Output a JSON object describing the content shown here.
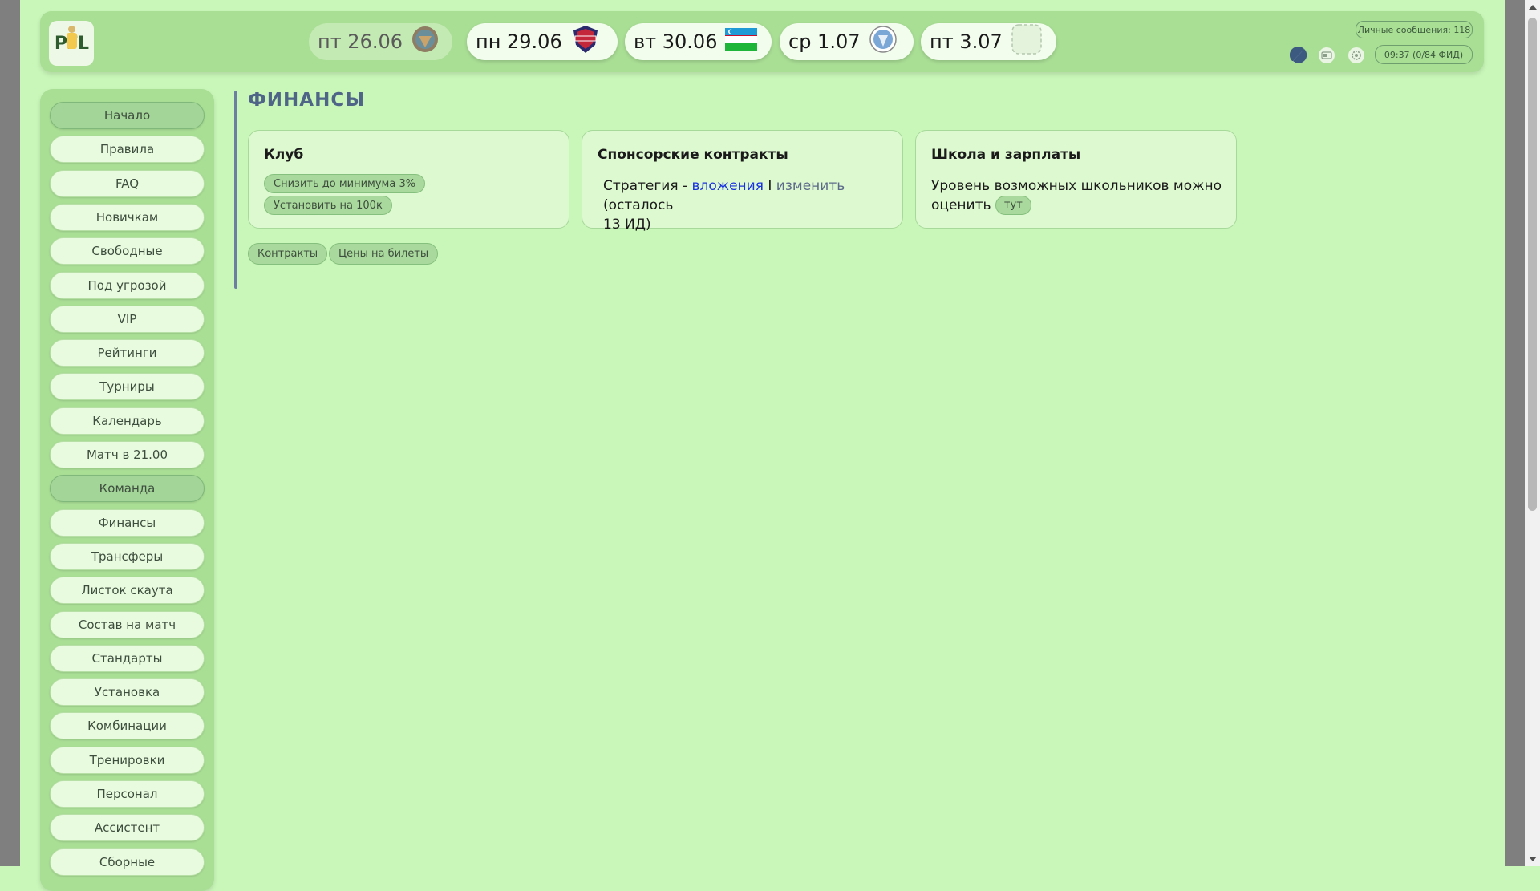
{
  "header": {
    "logo_text": "PFL",
    "matches": [
      {
        "date": "пт 26.06",
        "badge": "club-badge-orange-icon",
        "state": "past"
      },
      {
        "date": "пн 29.06",
        "badge": "club-badge-shield-red-icon",
        "state": "upcoming"
      },
      {
        "date": "вт 30.06",
        "badge": "uzbekistan-flag-icon",
        "state": "upcoming"
      },
      {
        "date": "ср 1.07",
        "badge": "club-badge-blue-icon",
        "state": "upcoming"
      },
      {
        "date": "пт 3.07",
        "badge": "empty-badge-icon",
        "state": "upcoming"
      }
    ],
    "messages_label": "Личные сообщения: 118",
    "status_label": "09:37 (0/84 ФИД)"
  },
  "sidebar": {
    "items": [
      {
        "label": "Начало",
        "active": true
      },
      {
        "label": "Правила",
        "active": false
      },
      {
        "label": "FAQ",
        "active": false
      },
      {
        "label": "Новичкам",
        "active": false
      },
      {
        "label": "Свободные",
        "active": false
      },
      {
        "label": "Под угрозой",
        "active": false
      },
      {
        "label": "VIP",
        "active": false
      },
      {
        "label": "Рейтинги",
        "active": false
      },
      {
        "label": "Турниры",
        "active": false
      },
      {
        "label": "Календарь",
        "active": false
      },
      {
        "label": "Матч в 21.00",
        "active": false
      },
      {
        "label": "Команда",
        "active": true
      },
      {
        "label": "Финансы",
        "active": false
      },
      {
        "label": "Трансферы",
        "active": false
      },
      {
        "label": "Листок скаута",
        "active": false
      },
      {
        "label": "Состав на матч",
        "active": false
      },
      {
        "label": "Стандарты",
        "active": false
      },
      {
        "label": "Установка",
        "active": false
      },
      {
        "label": "Комбинации",
        "active": false
      },
      {
        "label": "Тренировки",
        "active": false
      },
      {
        "label": "Персонал",
        "active": false
      },
      {
        "label": "Ассистент",
        "active": false
      },
      {
        "label": "Сборные",
        "active": false
      }
    ]
  },
  "main": {
    "title": "ФИНАНСЫ",
    "club_card": {
      "title": "Клуб",
      "min_button": "Снизить до минимума 3%",
      "set_button": "Установить на 100к"
    },
    "sponsor_card": {
      "title": "Спонсорские контракты",
      "strategy_prefix": "Стратегия - ",
      "strategy_link": "вложения",
      "separator": " I ",
      "change_link": "изменить",
      "remaining_line1": " (осталось",
      "remaining_line2": "13 ИД)"
    },
    "school_card": {
      "title": "Школа и зарплаты",
      "text_line1": "Уровень возможных школьников можно",
      "text_line2": "оценить ",
      "here_button": "тут"
    },
    "bottom_buttons": {
      "contracts": "Контракты",
      "tickets": "Цены на билеты"
    }
  },
  "colors": {
    "background": "#c9f7b9",
    "panel": "#a9de95",
    "accent": "#4f6587",
    "link": "#1a33e0"
  }
}
